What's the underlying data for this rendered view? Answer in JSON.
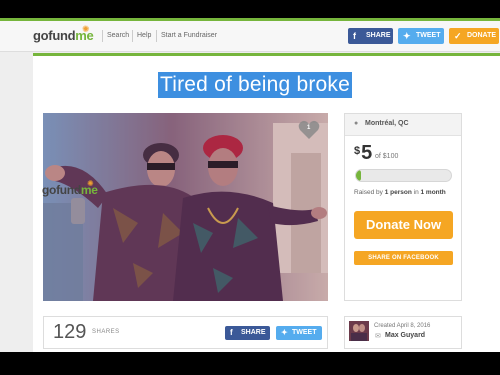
{
  "header": {
    "logo_go": "go",
    "logo_fund": "fund",
    "logo_me": "me",
    "nav": [
      "Search",
      "Help",
      "Start a Fundraiser"
    ],
    "share_label": "SHARE",
    "tweet_label": "TWEET",
    "donate_label": "DONATE"
  },
  "campaign": {
    "title": "Tired of being broke",
    "heart_count": "1",
    "location": "Montréal, QC",
    "currency": "$",
    "raised_amount": "5",
    "goal_text": "of $100",
    "progress_fraction": 0.05,
    "raised_prefix": "Raised by",
    "raised_people": "1 person",
    "raised_in": "in",
    "raised_duration": "1 month",
    "donate_now_label": "Donate Now",
    "share_facebook_label": "SHARE ON FACEBOOK"
  },
  "shares": {
    "count": "129",
    "label": "SHARES",
    "share_label": "SHARE",
    "tweet_label": "TWEET"
  },
  "creator": {
    "created": "Created April 8, 2016",
    "name": "Max Guyard"
  },
  "colors": {
    "brand_green": "#76b53c",
    "donate_orange": "#f5a623",
    "facebook_blue": "#3b5998",
    "twitter_blue": "#55acee",
    "title_highlight": "#3d8fe0"
  }
}
